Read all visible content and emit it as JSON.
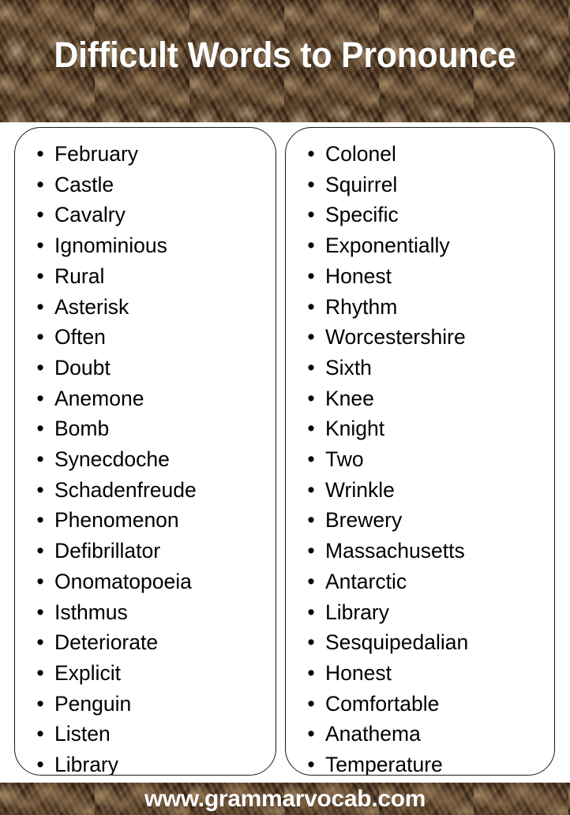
{
  "header": {
    "title": "Difficult Words to Pronounce",
    "background_color": "#4a3422",
    "text_color": "#ffffff"
  },
  "columns": [
    {
      "name": "left-column",
      "bullet": "•",
      "items": [
        "February",
        "Castle",
        "Cavalry",
        "Ignominious",
        "Rural",
        "Asterisk",
        "Often",
        "Doubt",
        "Anemone",
        "Bomb",
        "Synecdoche",
        "Schadenfreude",
        "Phenomenon",
        "Defibrillator",
        "Onomatopoeia",
        "Isthmus",
        "Deteriorate",
        "Explicit",
        "Penguin",
        "Listen",
        "Library"
      ]
    },
    {
      "name": "right-column",
      "bullet": "•",
      "items": [
        "Colonel",
        "Squirrel",
        "Specific",
        "Exponentially",
        "Honest",
        "Rhythm",
        "Worcestershire",
        "Sixth",
        "Knee",
        "Knight",
        "Two",
        "Wrinkle",
        "Brewery",
        "Massachusetts",
        "Antarctic",
        "Library",
        "Sesquipedalian",
        "Honest",
        "Comfortable",
        "Anathema",
        "Temperature"
      ]
    }
  ],
  "footer": {
    "url": "www.grammarvocab.com",
    "background_color": "#4a3422",
    "text_color": "#ffffff"
  }
}
